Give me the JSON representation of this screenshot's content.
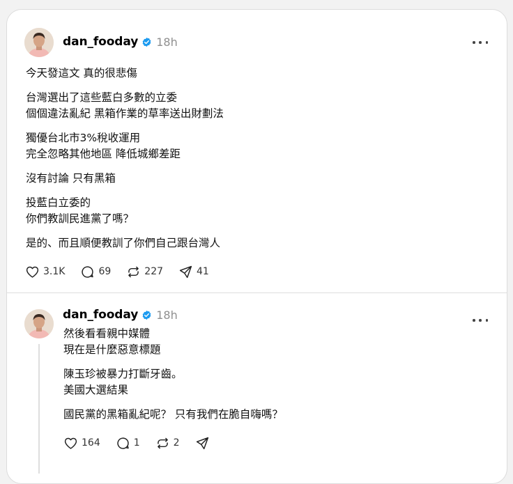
{
  "posts": [
    {
      "username": "dan_fooday",
      "time": "18h",
      "paragraphs": [
        [
          "今天發這文 真的很悲傷"
        ],
        [
          "台灣選出了這些藍白多數的立委",
          "個個違法亂紀 黑箱作業的草率送出財劃法"
        ],
        [
          "獨優台北市3%稅收運用",
          "完全忽略其他地區 降低城鄉差距"
        ],
        [
          "沒有討論 只有黑箱"
        ],
        [
          "投藍白立委的",
          "你們教訓民進黨了嗎？"
        ],
        [
          "是的、而且順便教訓了你們自己跟台灣人"
        ]
      ],
      "actions": {
        "like": "3.1K",
        "reply": "69",
        "repost": "227",
        "share": "41"
      }
    },
    {
      "username": "dan_fooday",
      "time": "18h",
      "paragraphs": [
        [
          "然後看看親中媒體",
          "現在是什麼惡意標題"
        ],
        [
          "陳玉珍被暴力打斷牙齒。",
          "美國大選結果"
        ],
        [
          "國民黨的黑箱亂紀呢？ 只有我們在脆自嗨嗎？"
        ]
      ],
      "actions": {
        "like": "164",
        "reply": "1",
        "repost": "2",
        "share": ""
      }
    }
  ],
  "icons": {
    "verified": "verified-badge-icon",
    "more": "more-options-icon",
    "like": "heart-icon",
    "reply": "comment-icon",
    "repost": "repost-icon",
    "share": "send-icon"
  },
  "colors": {
    "verified": "#1d9bf0",
    "muted": "#8f8f8f",
    "card": "#ffffff",
    "background": "#f2f2f2"
  }
}
